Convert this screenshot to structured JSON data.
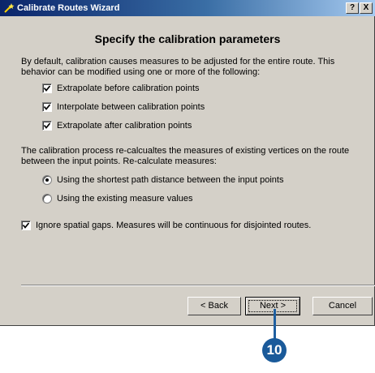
{
  "window": {
    "title": "Calibrate Routes Wizard",
    "help_button": "?",
    "close_button": "X"
  },
  "heading": "Specify the calibration parameters",
  "intro_text": "By default, calibration causes measures to be adjusted for the entire route. This behavior can be modified using one or more of the following:",
  "checkboxes": [
    {
      "label": "Extrapolate before calibration points",
      "checked": true
    },
    {
      "label": "Interpolate between calibration points",
      "checked": true
    },
    {
      "label": "Extrapolate after calibration points",
      "checked": true
    }
  ],
  "recalc_text": "The calibration process re-calcualtes the measures of existing vertices on the route between the input points. Re-calculate measures:",
  "radios": [
    {
      "label": "Using the shortest path distance between the input points",
      "selected": true
    },
    {
      "label": "Using the existing measure values",
      "selected": false
    }
  ],
  "gaps_checkbox": {
    "label": "Ignore spatial gaps.  Measures will be continuous for disjointed routes.",
    "checked": true
  },
  "buttons": {
    "back": "< Back",
    "next": "Next >",
    "cancel": "Cancel"
  },
  "callout_number": "10",
  "colors": {
    "dialog_face": "#d4d0c8",
    "title_start": "#0a246a",
    "title_end": "#a6caf0",
    "callout": "#1a5a9a"
  }
}
